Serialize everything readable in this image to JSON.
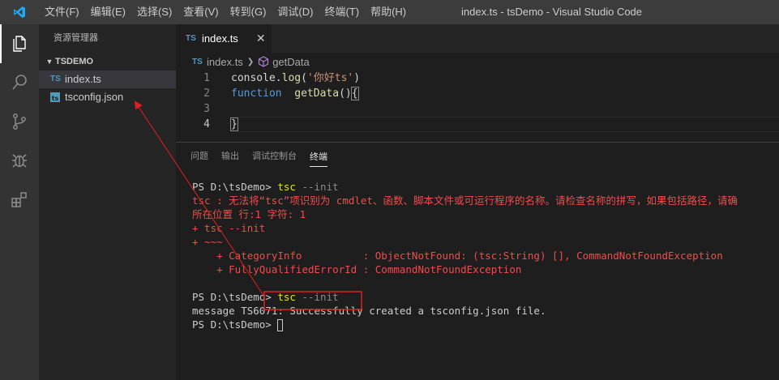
{
  "titlebar": {
    "menu": [
      "文件(F)",
      "编辑(E)",
      "选择(S)",
      "查看(V)",
      "转到(G)",
      "调试(D)",
      "终端(T)",
      "帮助(H)"
    ],
    "window_title": "index.ts - tsDemo - Visual Studio Code"
  },
  "activitybar": {
    "icons": [
      "files-icon",
      "search-icon",
      "source-control-icon",
      "debug-icon",
      "extensions-icon"
    ]
  },
  "sidebar": {
    "title": "资源管理器",
    "folder": "TSDEMO",
    "files": [
      {
        "badge": "TS",
        "name": "index.ts"
      },
      {
        "badge": "",
        "name": "tsconfig.json"
      }
    ]
  },
  "editor": {
    "tab": {
      "badge": "TS",
      "label": "index.ts",
      "close": "✕"
    },
    "breadcrumb": {
      "file": "index.ts",
      "symbol": "getData"
    },
    "lines": [
      {
        "num": "1",
        "parts": [
          [
            "plain",
            "console."
          ],
          [
            "fn",
            "log"
          ],
          [
            "plain",
            "("
          ],
          [
            "str",
            "'你好ts'"
          ],
          [
            "plain",
            ")"
          ]
        ]
      },
      {
        "num": "2",
        "parts": [
          [
            "kw",
            "function"
          ],
          [
            "plain",
            "  "
          ],
          [
            "fn",
            "getData"
          ],
          [
            "plain",
            "()"
          ],
          [
            "plain",
            "{"
          ]
        ]
      },
      {
        "num": "3",
        "parts": []
      },
      {
        "num": "4",
        "parts": [
          [
            "plain",
            "}"
          ]
        ]
      }
    ]
  },
  "panel": {
    "tabs": [
      "问题",
      "输出",
      "调试控制台",
      "终端"
    ],
    "active_tab": "终端",
    "terminal": [
      [
        [
          "t-white",
          "PS D:\\tsDemo> "
        ],
        [
          "t-yellow",
          "tsc"
        ],
        [
          "t-gray",
          " --init"
        ]
      ],
      [
        [
          "t-red",
          "tsc : 无法将“tsc”项识别为 cmdlet、函数、脚本文件或可运行程序的名称。请检查名称的拼写，如果包括路径，请确"
        ]
      ],
      [
        [
          "t-red",
          "所在位置 行:1 字符: 1"
        ]
      ],
      [
        [
          "t-red",
          "+ tsc --init"
        ]
      ],
      [
        [
          "t-red",
          "+ ~~~"
        ]
      ],
      [
        [
          "t-red",
          "    + CategoryInfo          : ObjectNotFound: (tsc:String) [], CommandNotFoundException"
        ]
      ],
      [
        [
          "t-red",
          "    + FullyQualifiedErrorId : CommandNotFoundException"
        ]
      ],
      [
        [
          "t-white",
          ""
        ]
      ],
      [
        [
          "t-white",
          "PS D:\\tsDemo> "
        ],
        [
          "t-yellow",
          "tsc"
        ],
        [
          "t-gray",
          " --init"
        ]
      ],
      [
        [
          "t-white",
          "message TS6071: Successfully created a tsconfig.json file."
        ]
      ],
      [
        [
          "t-white",
          "PS D:\\tsDemo> "
        ]
      ]
    ]
  },
  "colors": {
    "annotation": "#e02020",
    "accent": "#007acc"
  }
}
